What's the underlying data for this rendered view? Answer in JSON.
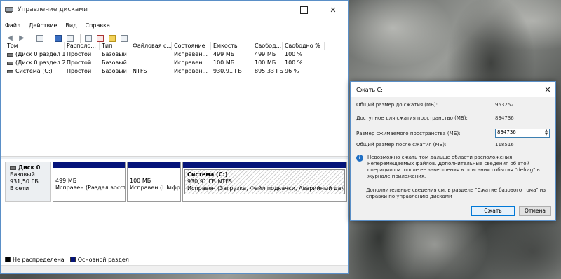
{
  "window": {
    "title": "Управление дисками",
    "menu": [
      "Файл",
      "Действие",
      "Вид",
      "Справка"
    ],
    "close_glyph": "✕"
  },
  "volumes": {
    "headers": [
      "Том",
      "Располо...",
      "Тип",
      "Файловая с...",
      "Состояние",
      "Емкость",
      "Свобод...",
      "Свободно %"
    ],
    "rows": [
      [
        "(Диск 0 раздел 1)",
        "Простой",
        "Базовый",
        "",
        "Исправен...",
        "499 МБ",
        "499 МБ",
        "100 %"
      ],
      [
        "(Диск 0 раздел 2)",
        "Простой",
        "Базовый",
        "",
        "Исправен...",
        "100 МБ",
        "100 МБ",
        "100 %"
      ],
      [
        "Система (C:)",
        "Простой",
        "Базовый",
        "NTFS",
        "Исправен...",
        "930,91 ГБ",
        "895,33 ГБ",
        "96 %"
      ]
    ]
  },
  "disk": {
    "name": "Диск 0",
    "type": "Базовый",
    "size": "931,50 ГБ",
    "status": "В сети",
    "partitions": [
      {
        "line1": "",
        "line2": "499 МБ",
        "line3": "Исправен (Раздел восстан"
      },
      {
        "line1": "",
        "line2": "100 МБ",
        "line3": "Исправен (Шифрова"
      },
      {
        "line1": "Система (C:)",
        "line2": "930,91 ГБ NTFS",
        "line3": "Исправен (Загрузка, Файл подкачки, Аварийный дамп памяти,"
      }
    ]
  },
  "legend": {
    "unallocated": "Не распределена",
    "primary": "Основной раздел"
  },
  "dialog": {
    "title": "Сжать C:",
    "close_glyph": "✕",
    "total_before_label": "Общий размер до сжатия (МБ):",
    "total_before_value": "953252",
    "available_label": "Доступное для сжатия пространство (МБ):",
    "available_value": "834736",
    "shrink_label": "Размер сжимаемого пространства (МБ):",
    "shrink_value": "834736",
    "total_after_label": "Общий размер после сжатия (МБ):",
    "total_after_value": "118516",
    "info_text": "Невозможно сжать том дальше области расположения неперемещаемых файлов. Дополнительные сведения об этой операции см. после ее завершения в описании события \"defrag\" в журнале приложения.",
    "more_text": "Дополнительные сведения см. в разделе \"Сжатие базового тома\" из справки по управлению дисками",
    "ok_label": "Сжать",
    "cancel_label": "Отмена"
  }
}
